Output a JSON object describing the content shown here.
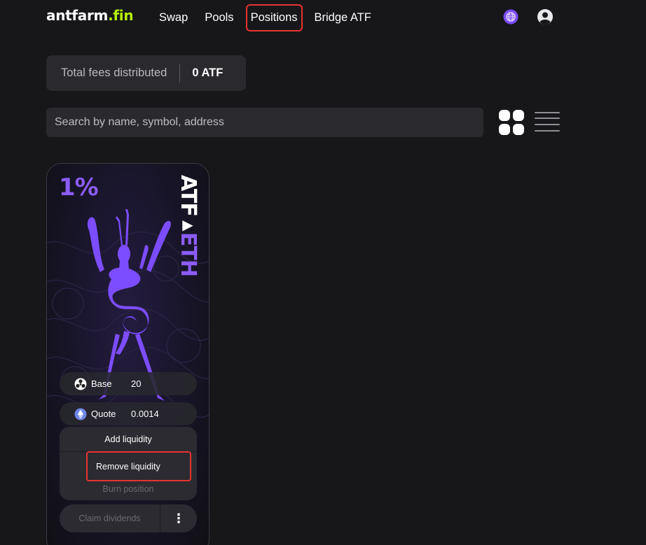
{
  "header": {
    "logo_main": "antfarm",
    "logo_accent": ".fin",
    "nav": [
      {
        "label": "Swap"
      },
      {
        "label": "Pools"
      },
      {
        "label": "Positions"
      },
      {
        "label": "Bridge ATF"
      }
    ],
    "icons": [
      "network-icon",
      "user-icon"
    ]
  },
  "fees": {
    "label": "Total fees distributed",
    "value": "0 ATF"
  },
  "search": {
    "placeholder": "Search by name, symbol, address"
  },
  "view_toggle": [
    "grid-view-icon",
    "list-view-icon"
  ],
  "position_card": {
    "fee_tier": "1%",
    "token_a": "ATF",
    "token_b": "ETH",
    "base": {
      "label": "Base",
      "value": "20",
      "icon": "atf-token-icon"
    },
    "quote": {
      "label": "Quote",
      "value": "0.0014",
      "icon": "eth-token-icon"
    },
    "actions": {
      "add": "Add liquidity",
      "remove": "Remove liquidity",
      "burn": "Burn position"
    },
    "claim": "Claim dividends",
    "more": "⋮"
  },
  "colors": {
    "background": "#17171a",
    "accent_purple": "#8b5cf6",
    "logo_accent": "#b4f000",
    "highlight": "#e8332e"
  }
}
